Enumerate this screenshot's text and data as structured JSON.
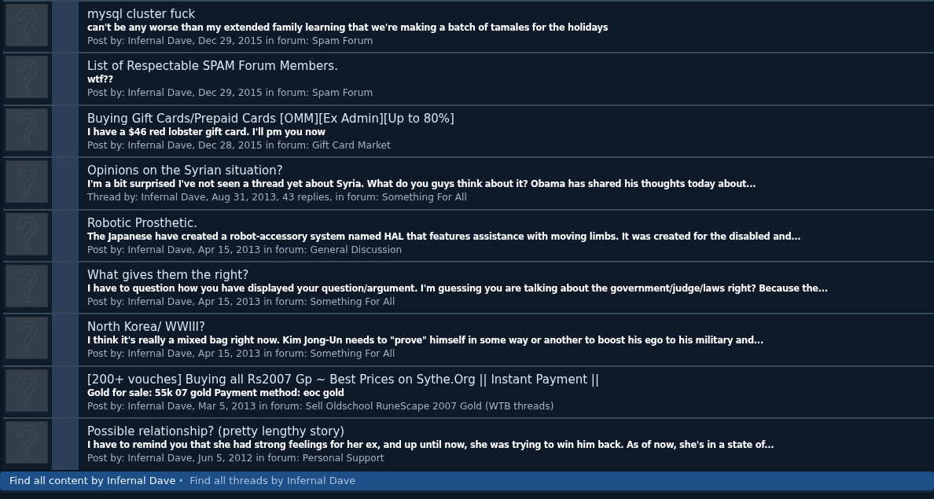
{
  "results": [
    {
      "title": "mysql cluster fuck",
      "snippet": "can't be any worse than my extended family learning that we're making a batch of tamales for the holidays",
      "meta": {
        "label": "Post by:",
        "author": "Infernal Dave",
        "details": ", Dec 29, 2015 in forum:",
        "forum": "Spam Forum"
      }
    },
    {
      "title": "List of Respectable SPAM Forum Members.",
      "snippet": "wtf??",
      "meta": {
        "label": "Post by:",
        "author": "Infernal Dave",
        "details": ", Dec 29, 2015 in forum:",
        "forum": "Spam Forum"
      }
    },
    {
      "title": "Buying Gift Cards/Prepaid Cards [OMM][Ex Admin][Up to 80%]",
      "snippet": "I have a $46 red lobster gift card. I'll pm you now",
      "meta": {
        "label": "Post by:",
        "author": "Infernal Dave",
        "details": ", Dec 28, 2015 in forum:",
        "forum": "Gift Card Market"
      }
    },
    {
      "title": "Opinions on the Syrian situation?",
      "snippet": "I'm a bit surprised I've not seen a thread yet about Syria. What do you guys think about it? Obama has shared his thoughts today about...",
      "meta": {
        "label": "Thread by:",
        "author": "Infernal Dave",
        "details": ", Aug 31, 2013, 43 replies, in forum:",
        "forum": "Something For All"
      }
    },
    {
      "title": "Robotic Prosthetic.",
      "snippet": "The Japanese have created a robot-accessory system named HAL that features assistance with moving limbs. It was created for the disabled and...",
      "meta": {
        "label": "Post by:",
        "author": "Infernal Dave",
        "details": ", Apr 15, 2013 in forum:",
        "forum": "General Discussion"
      }
    },
    {
      "title": "What gives them the right?",
      "snippet": "I have to question how you have displayed your question/argument. I'm guessing you are talking about the government/judge/laws right? Because the...",
      "meta": {
        "label": "Post by:",
        "author": "Infernal Dave",
        "details": ", Apr 15, 2013 in forum:",
        "forum": "Something For All"
      }
    },
    {
      "title": "North Korea/ WWIII?",
      "snippet": "I think it's really a mixed bag right now. Kim Jong-Un needs to \"prove\" himself in some way or another to boost his ego to his military and...",
      "meta": {
        "label": "Post by:",
        "author": "Infernal Dave",
        "details": ", Apr 15, 2013 in forum:",
        "forum": "Something For All"
      }
    },
    {
      "title": "[200+ vouches] Buying all Rs2007 Gp ~ Best Prices on Sythe.Org || Instant Payment ||",
      "snippet": "Gold for sale: 55k 07 gold Payment method: eoc gold",
      "meta": {
        "label": "Post by:",
        "author": "Infernal Dave",
        "details": ", Mar 5, 2013 in forum:",
        "forum": "Sell Oldschool RuneScape 2007 Gold (WTB threads)"
      }
    },
    {
      "title": "Possible relationship? (pretty lengthy story)",
      "snippet": "I have to remind you that she had strong feelings for her ex, and up until now, she was trying to win him back. As of now, she's in a state of...",
      "meta": {
        "label": "Post by:",
        "author": "Infernal Dave",
        "details": ", Jun 5, 2012 in forum:",
        "forum": "Personal Support"
      }
    }
  ],
  "footer": {
    "links": [
      "Find all content by Infernal Dave",
      "Find all threads by Infernal Dave"
    ],
    "separator": "•"
  }
}
